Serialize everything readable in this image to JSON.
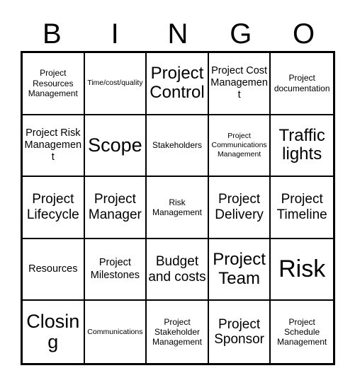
{
  "card": {
    "title": "BINGO",
    "header_letters": [
      "B",
      "I",
      "N",
      "G",
      "O"
    ],
    "columns": 5,
    "rows": 5,
    "colors": {
      "background": "#ffffff",
      "border": "#000000",
      "text": "#000000"
    },
    "cells": [
      {
        "label": "Project Resources Management",
        "size": "fs-s"
      },
      {
        "label": "Time/cost/quality",
        "size": "fs-xs"
      },
      {
        "label": "Project Control",
        "size": "fs-xl"
      },
      {
        "label": "Project Cost Management",
        "size": "fs-m"
      },
      {
        "label": "Project documentation",
        "size": "fs-s"
      },
      {
        "label": "Project Risk Management",
        "size": "fs-m"
      },
      {
        "label": "Scope",
        "size": "fs-xxl"
      },
      {
        "label": "Stakeholders",
        "size": "fs-s"
      },
      {
        "label": "Project Communications Management",
        "size": "fs-xs"
      },
      {
        "label": "Traffic lights",
        "size": "fs-xl"
      },
      {
        "label": "Project Lifecycle",
        "size": "fs-l"
      },
      {
        "label": "Project Manager",
        "size": "fs-l"
      },
      {
        "label": "Risk Management",
        "size": "fs-s"
      },
      {
        "label": "Project Delivery",
        "size": "fs-l"
      },
      {
        "label": "Project Timeline",
        "size": "fs-l"
      },
      {
        "label": "Resources",
        "size": "fs-m"
      },
      {
        "label": "Project Milestones",
        "size": "fs-m"
      },
      {
        "label": "Budget and costs",
        "size": "fs-l"
      },
      {
        "label": "Project Team",
        "size": "fs-xl"
      },
      {
        "label": "Risk",
        "size": "fs-3xl"
      },
      {
        "label": "Closing",
        "size": "fs-xxl"
      },
      {
        "label": "Communications",
        "size": "fs-xs"
      },
      {
        "label": "Project Stakeholder Management",
        "size": "fs-s"
      },
      {
        "label": "Project Sponsor",
        "size": "fs-l"
      },
      {
        "label": "Project Schedule Management",
        "size": "fs-s"
      }
    ]
  }
}
